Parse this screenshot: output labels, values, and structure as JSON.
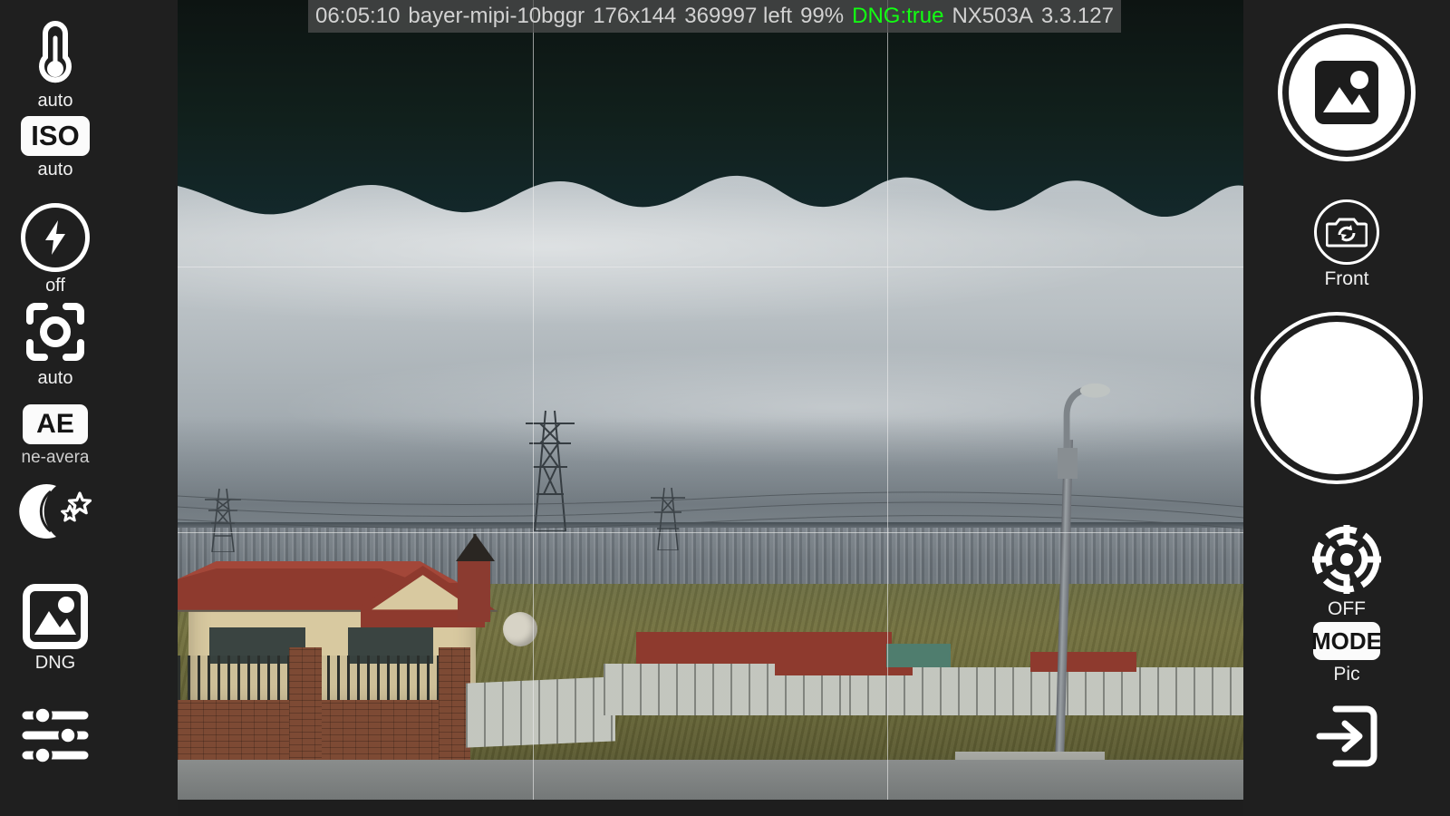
{
  "app": {
    "name": "Camera RAW Preview",
    "background_color": "#1f1f1f",
    "accent_color": "#ffffff",
    "dng_color": "#12ff12"
  },
  "statusbar": {
    "timestamp": "06:05:10",
    "format": "bayer-mipi-10bggr",
    "resolution": "176x144",
    "frames_left": "369997 left",
    "battery": "99%",
    "dng": "DNG:true",
    "device": "NX503A",
    "version": "3.3.127"
  },
  "left_controls": [
    {
      "icon": "thermometer-icon",
      "name": "white-balance",
      "label": "auto"
    },
    {
      "icon": "iso-badge-icon",
      "name": "iso",
      "label": "auto",
      "badge_text": "ISO"
    },
    {
      "icon": "flash-icon",
      "name": "flash",
      "label": "off"
    },
    {
      "icon": "focus-brackets-icon",
      "name": "focus",
      "label": "auto"
    },
    {
      "icon": "ae-badge-icon",
      "name": "exposure-metering",
      "label": "ne-avera",
      "badge_text": "AE"
    },
    {
      "icon": "moon-stars-icon",
      "name": "night-mode",
      "label": ""
    },
    {
      "icon": "image-icon",
      "name": "image-format",
      "label": "DNG"
    },
    {
      "icon": "sliders-icon",
      "name": "settings",
      "label": ""
    }
  ],
  "right_controls": {
    "gallery": {
      "icon": "image-icon",
      "name": "gallery",
      "label": ""
    },
    "camera_switch": {
      "icon": "camera-flip-icon",
      "label": "Front"
    },
    "shutter": {
      "icon": "shutter-icon",
      "label": ""
    },
    "timer": {
      "icon": "target-crosshair-icon",
      "label": "OFF"
    },
    "mode": {
      "icon": "mode-badge-icon",
      "badge_text": "MODE",
      "label": "Pic"
    },
    "exit": {
      "icon": "exit-arrow-icon",
      "label": ""
    }
  },
  "preview": {
    "grid_enabled": true,
    "grid_type": "rule-of-thirds",
    "scene_description": "Overcast suburban view with houses, red roofs, brick wall, grass field, street lamp and power pylons"
  }
}
